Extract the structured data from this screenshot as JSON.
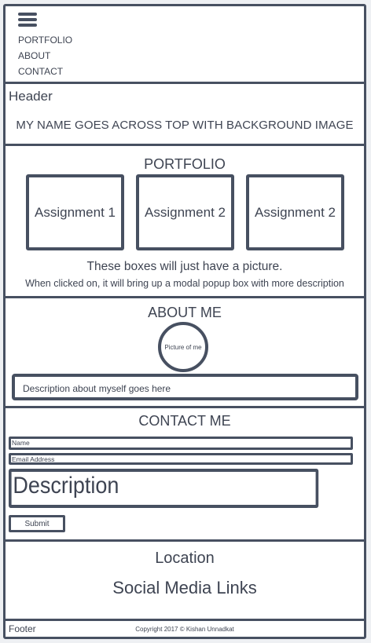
{
  "nav": {
    "items": [
      "PORTFOLIO",
      "ABOUT",
      "CONTACT"
    ]
  },
  "header": {
    "label": "Header",
    "text": "MY NAME GOES ACROSS TOP WITH BACKGROUND IMAGE"
  },
  "portfolio": {
    "title": "PORTFOLIO",
    "boxes": [
      "Assignment 1",
      "Assignment 2",
      "Assignment 2"
    ],
    "caption": "These boxes will just have a picture.",
    "subcaption": "When clicked on, it will bring up a modal popup box with more description"
  },
  "about": {
    "title": "ABOUT ME",
    "picture_label": "Picture of me",
    "description": "Description about myself goes here"
  },
  "contact": {
    "title": "CONTACT ME",
    "name_placeholder": "Name",
    "email_placeholder": "Email Address",
    "description_placeholder": "Description",
    "submit_label": "Submit"
  },
  "location": {
    "label": "Location",
    "social": "Social Media Links"
  },
  "footer": {
    "label": "Footer",
    "copyright": "Copyright 2017 © Kishan Unnadkat"
  }
}
